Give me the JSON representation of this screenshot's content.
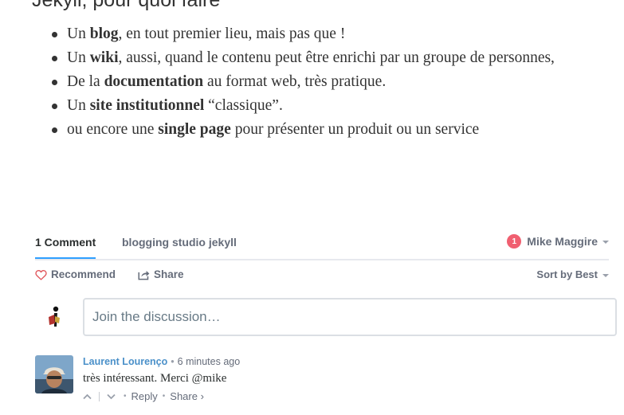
{
  "article": {
    "heading": "Jekyll, pour quoi faire",
    "bullets": [
      {
        "pre": "Un ",
        "bold": "blog",
        "post": ", en tout premier lieu, mais pas que !"
      },
      {
        "pre": "Un ",
        "bold": "wiki",
        "post": ", aussi, quand le contenu peut être enrichi par un groupe de personnes,"
      },
      {
        "pre": "De la ",
        "bold": "documentation",
        "post": " au format web, très pratique."
      },
      {
        "pre": "Un ",
        "bold": "site institutionnel",
        "post": " “classique”."
      },
      {
        "pre": "ou encore une ",
        "bold": "single page",
        "post": " pour présenter un produit ou un service"
      }
    ]
  },
  "comments_nav": {
    "count_label": "1 Comment",
    "community_label": "blogging studio jekyll",
    "user_name": "Mike Maggire",
    "notification_count": "1"
  },
  "actions": {
    "recommend_label": "Recommend",
    "share_label": "Share",
    "sort_label": "Sort by Best"
  },
  "composer": {
    "placeholder": "Join the discussion…"
  },
  "comment": {
    "author": "Laurent Lourenço",
    "separator": "•",
    "time": "6 minutes ago",
    "text": "très intéressant. Merci @mike",
    "reply_label": "Reply",
    "share_label": "Share ›",
    "dot": "•"
  },
  "colors": {
    "accent_blue": "#2e9fff",
    "badge_red": "#f05f70",
    "author_blue": "#4a90c9",
    "heart_red": "#e0565b"
  },
  "icons": {
    "recommend": "heart-icon",
    "share": "share-icon",
    "upvote": "chevron-up-icon",
    "downvote": "chevron-down-icon"
  }
}
